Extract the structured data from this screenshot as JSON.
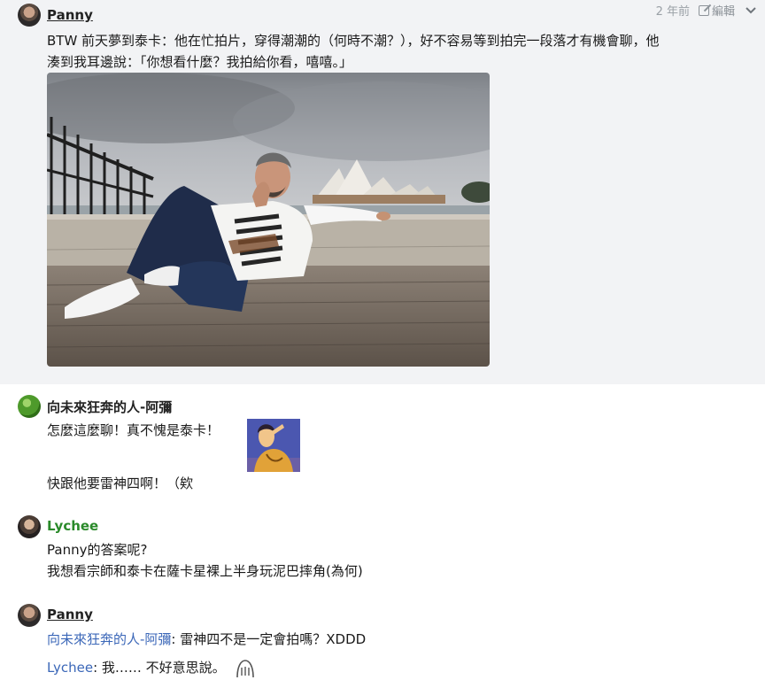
{
  "post1": {
    "author": "Panny",
    "time": "2 年前",
    "edit_label": "編輯",
    "text_line1": "BTW 前天夢到泰卡：他在忙拍片，穿得潮潮的（何時不潮？），好不容易等到拍完一段落才有機會聊，他",
    "text_line2": "湊到我耳邊說：「你想看什麼？我拍給你看，嘻嘻。」"
  },
  "comment1": {
    "author": "向未來狂奔的人-阿彌",
    "line1": "怎麼這麼聊！真不愧是泰卡！",
    "line2": "快跟他要雷神四啊！（欸"
  },
  "comment2": {
    "author": "Lychee",
    "line1": "Panny的答案呢?",
    "line2": "我想看宗師和泰卡在薩卡星裸上半身玩泥巴摔角(為何)"
  },
  "comment3": {
    "author": "Panny",
    "mention1": "向未來狂奔的人-阿彌",
    "reply1": ": 雷神四不是一定會拍嗎？XDDD",
    "mention2": "Lychee",
    "reply2": ": 我…… 不好意思說。"
  },
  "icons": {
    "avatar_panny": "avatar-icon",
    "edit": "edit-icon",
    "chevron": "chevron-down-icon",
    "sticker": "sticker-image",
    "emoji": "shy-face-icon"
  },
  "colors": {
    "post_background": "#f2f3f5",
    "mention": "#3b67b8",
    "lychee_name": "#2a8a2a"
  }
}
